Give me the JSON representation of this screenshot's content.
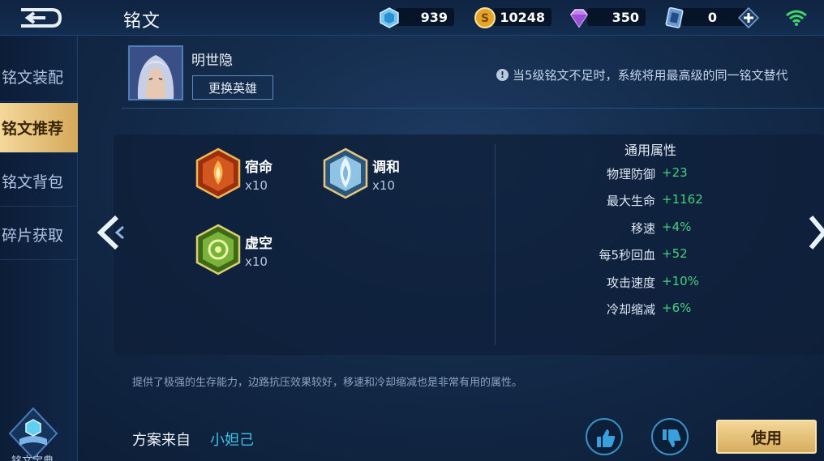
{
  "header": {
    "title": "铭文",
    "back_icon": "back-arrow-icon",
    "currencies": [
      {
        "name": "voucher",
        "icon": "blue-crystal-icon",
        "value": "939"
      },
      {
        "name": "gold",
        "icon": "gold-coin-icon",
        "value": "10248"
      },
      {
        "name": "diamond",
        "icon": "purple-diamond-icon",
        "value": "350"
      },
      {
        "name": "ticket",
        "icon": "blue-card-icon",
        "value": "0"
      }
    ],
    "add_icon": "plus-icon",
    "signal_icon": "wifi-icon"
  },
  "sidebar": {
    "items": [
      {
        "label": "铭文装配",
        "active": false
      },
      {
        "label": "铭文推荐",
        "active": true
      },
      {
        "label": "铭文背包",
        "active": false
      },
      {
        "label": "碎片获取",
        "active": false
      }
    ],
    "codex_label": "铭文宝典"
  },
  "hero": {
    "name": "明世隐",
    "change_button": "更换英雄",
    "notice": "当5级铭文不足时，系统将用最高级的同一铭文替代"
  },
  "runes": [
    {
      "name": "宿命",
      "count": "x10",
      "color": "#d2581f"
    },
    {
      "name": "调和",
      "count": "x10",
      "color": "#8fc3e6"
    },
    {
      "name": "虚空",
      "count": "x10",
      "color": "#7bb33a"
    }
  ],
  "attributes": {
    "title": "通用属性",
    "rows": [
      {
        "label": "物理防御",
        "value": "+23"
      },
      {
        "label": "最大生命",
        "value": "+1162"
      },
      {
        "label": "移速",
        "value": "+4%"
      },
      {
        "label": "每5秒回血",
        "value": "+52"
      },
      {
        "label": "攻击速度",
        "value": "+10%"
      },
      {
        "label": "冷却缩减",
        "value": "+6%"
      }
    ]
  },
  "description": "提供了极强的生存能力，边路抗压效果较好，移速和冷却缩减也是非常有用的属性。",
  "footer": {
    "source_label": "方案来自",
    "source_value": "小妲己",
    "use_button": "使用",
    "like_icon": "thumbs-up-icon",
    "dislike_icon": "thumbs-down-icon"
  },
  "colors": {
    "accent_gold": "#d7ad5f",
    "positive_green": "#46d07c",
    "link_cyan": "#3fc1e6"
  }
}
